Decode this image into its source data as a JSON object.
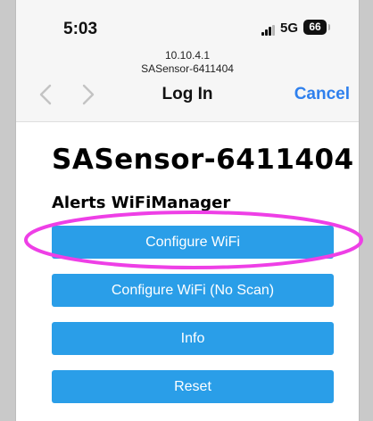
{
  "status_bar": {
    "time": "5:03",
    "network": "5G",
    "battery": "66"
  },
  "browser": {
    "url_host": "10.10.4.1",
    "url_title": "SASensor-6411404",
    "title": "Log In",
    "cancel_label": "Cancel"
  },
  "page": {
    "device_name": "SASensor-6411404",
    "subtitle": "Alerts WiFiManager",
    "buttons": [
      {
        "label": "Configure WiFi"
      },
      {
        "label": "Configure WiFi (No Scan)"
      },
      {
        "label": "Info"
      },
      {
        "label": "Reset"
      }
    ]
  },
  "annotation": {
    "color": "#ee3fe6"
  }
}
